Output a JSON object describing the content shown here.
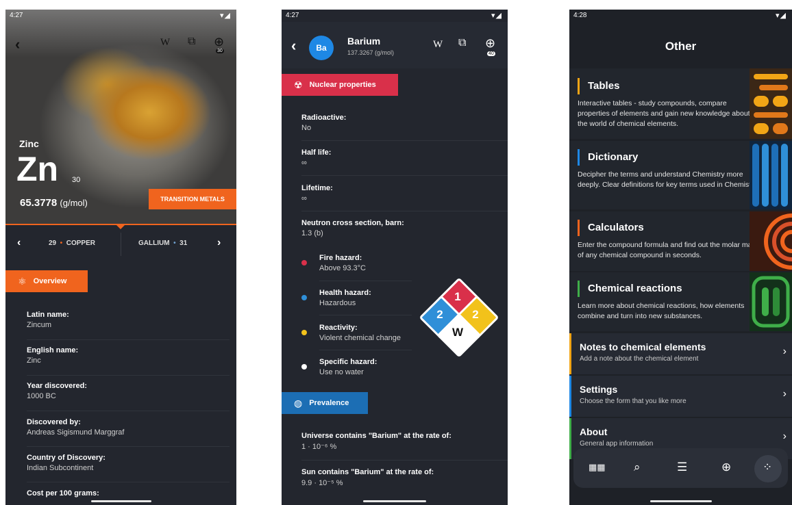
{
  "phone1": {
    "status_time": "4:27",
    "element_name": "Zinc",
    "symbol": "Zn",
    "atomic_number": "30",
    "mass_value": "65.3778",
    "mass_unit": "(g/mol)",
    "category": "TRANSITION METALS",
    "wiki": "W",
    "badge": "30",
    "prev": {
      "num": "29",
      "name": "COPPER"
    },
    "next": {
      "name": "GALLIUM",
      "num": "31"
    },
    "section": "Overview",
    "props": [
      {
        "label": "Latin name:",
        "value": "Zincum"
      },
      {
        "label": "English name:",
        "value": "Zinc"
      },
      {
        "label": "Year discovered:",
        "value": "1000 BC"
      },
      {
        "label": "Discovered by:",
        "value": "Andreas Sigismund Marggraf"
      },
      {
        "label": "Country of Discovery:",
        "value": "Indian Subcontinent"
      },
      {
        "label": "Cost per 100 grams:",
        "value": ""
      }
    ]
  },
  "phone2": {
    "status_time": "4:27",
    "avatar": "Ba",
    "title": "Barium",
    "subtitle": "137.3267 (g/mol)",
    "wiki": "W",
    "badge": "40",
    "section_nuclear": "Nuclear properties",
    "props": [
      {
        "label": "Radioactive:",
        "value": "No"
      },
      {
        "label": "Half life:",
        "value": "∞"
      },
      {
        "label": "Lifetime:",
        "value": "∞"
      },
      {
        "label": "Neutron cross section, barn:",
        "value": "1.3 (b)"
      }
    ],
    "hazards": [
      {
        "label": "Fire hazard:",
        "value": "Above 93.3°C",
        "color": "#d9304a"
      },
      {
        "label": "Health hazard:",
        "value": "Hazardous",
        "color": "#2f8fd8"
      },
      {
        "label": "Reactivity:",
        "value": "Violent chemical change",
        "color": "#f2c21b"
      },
      {
        "label": "Specific hazard:",
        "value": "Use no water",
        "color": "#ffffff"
      }
    ],
    "diamond": {
      "fire": "1",
      "health": "2",
      "reactivity": "2",
      "special": "W"
    },
    "section_prevalence": "Prevalence",
    "prevalence": [
      {
        "label": "Universe contains \"Barium\" at the rate of:",
        "value": "1 · 10⁻⁶ %"
      },
      {
        "label": "Sun contains \"Barium\" at the rate of:",
        "value": "9.9 · 10⁻⁵ %"
      }
    ]
  },
  "phone3": {
    "status_time": "4:28",
    "title": "Other",
    "cards": [
      {
        "title": "Tables",
        "desc": "Interactive tables - study compounds, compare properties of elements and gain new knowledge about the world of chemical elements.",
        "color": "#f2a516"
      },
      {
        "title": "Dictionary",
        "desc": "Decipher the terms and understand Chemistry more deeply. Clear definitions for key terms used in Chemistry.",
        "color": "#1e88e5"
      },
      {
        "title": "Calculators",
        "desc": "Enter the compound formula and find out the molar mass of any chemical compound in seconds.",
        "color": "#f0641e"
      },
      {
        "title": "Chemical reactions",
        "desc": "Learn more about chemical reactions, how elements combine and turn into new substances.",
        "color": "#3fae49"
      }
    ],
    "list": [
      {
        "title": "Notes to chemical elements",
        "sub": "Add a note about the chemical element",
        "color": "#f2a516"
      },
      {
        "title": "Settings",
        "sub": "Choose the form that you like more",
        "color": "#1e88e5"
      },
      {
        "title": "About",
        "sub": "General app information",
        "color": "#3fae49"
      }
    ],
    "nav_icons": [
      "periodic-table-icon",
      "search-icon",
      "list-icon",
      "add-atom-icon",
      "more-icon"
    ]
  }
}
